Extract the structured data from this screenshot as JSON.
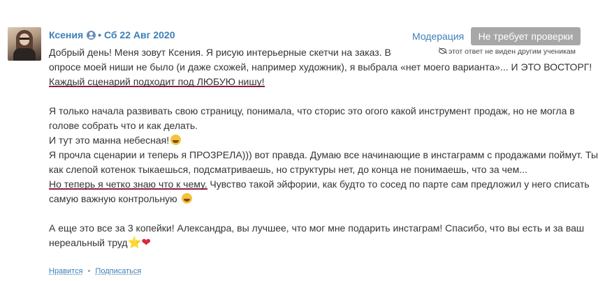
{
  "comment": {
    "author": "Ксения",
    "separator": "•",
    "date": "Сб 22 Авг 2020",
    "moderation_label": "Модерация",
    "no_review_label": "Не требует проверки",
    "hidden_note": "этот ответ не виден другим ученикам",
    "p1": {
      "l1": "Добрый день! Меня зовут Ксения. Я рисую интерьерные скетчи на заказ. В",
      "l2": "опросе моей ниши не было (и даже схожей, например художник), я выбрала «нет моего варианта»... И ЭТО ВОСТОРГ!",
      "l3": "Каждый сценарий подходит под ЛЮБУЮ нишу!"
    },
    "p2": {
      "l1": "Я только начала развивать свою страницу, понимала, что сторис это огого какой инструмент продаж, но не могла в",
      "l2": "голове собрать что и как делать.",
      "l3": "И тут это манна небесная!",
      "l4": "Я прочла сценарии и теперь я ПРОЗРЕЛА))) вот правда. Думаю все начинающие в инстаграмм с продажами поймут. Ты",
      "l5": "как слепой котенок тыкаешься, подсматриваешь, но структуры нет, до конца не понимаешь, что за чем...",
      "l6a": "Но теперь я четко знаю что к чему.",
      "l6b": " Чувство такой эйфории, как будто то сосед по парте сам предложил у него списать",
      "l7": "самую важную контрольную"
    },
    "p3": {
      "l1": "А еще это все за 3 копейки! Александра, вы лучшее, что мог мне подарить инстаграм! Спасибо, что вы есть и за ваш",
      "l2": "нереальный труд"
    },
    "star_glyph": "⭐",
    "heart_glyph": "❤",
    "like_label": "Нравится",
    "footer_separator": "•",
    "subscribe_label": "Подписаться"
  },
  "colors": {
    "link": "#3d7fb8",
    "underline_accent": "#8c1c44",
    "button_bg": "#a7a7a7",
    "text": "#333333"
  },
  "icons": [
    "user-verified-icon",
    "eye-crossed-icon",
    "laughing-emoji-icon",
    "grinning-emoji-icon",
    "star-icon",
    "heart-icon"
  ]
}
